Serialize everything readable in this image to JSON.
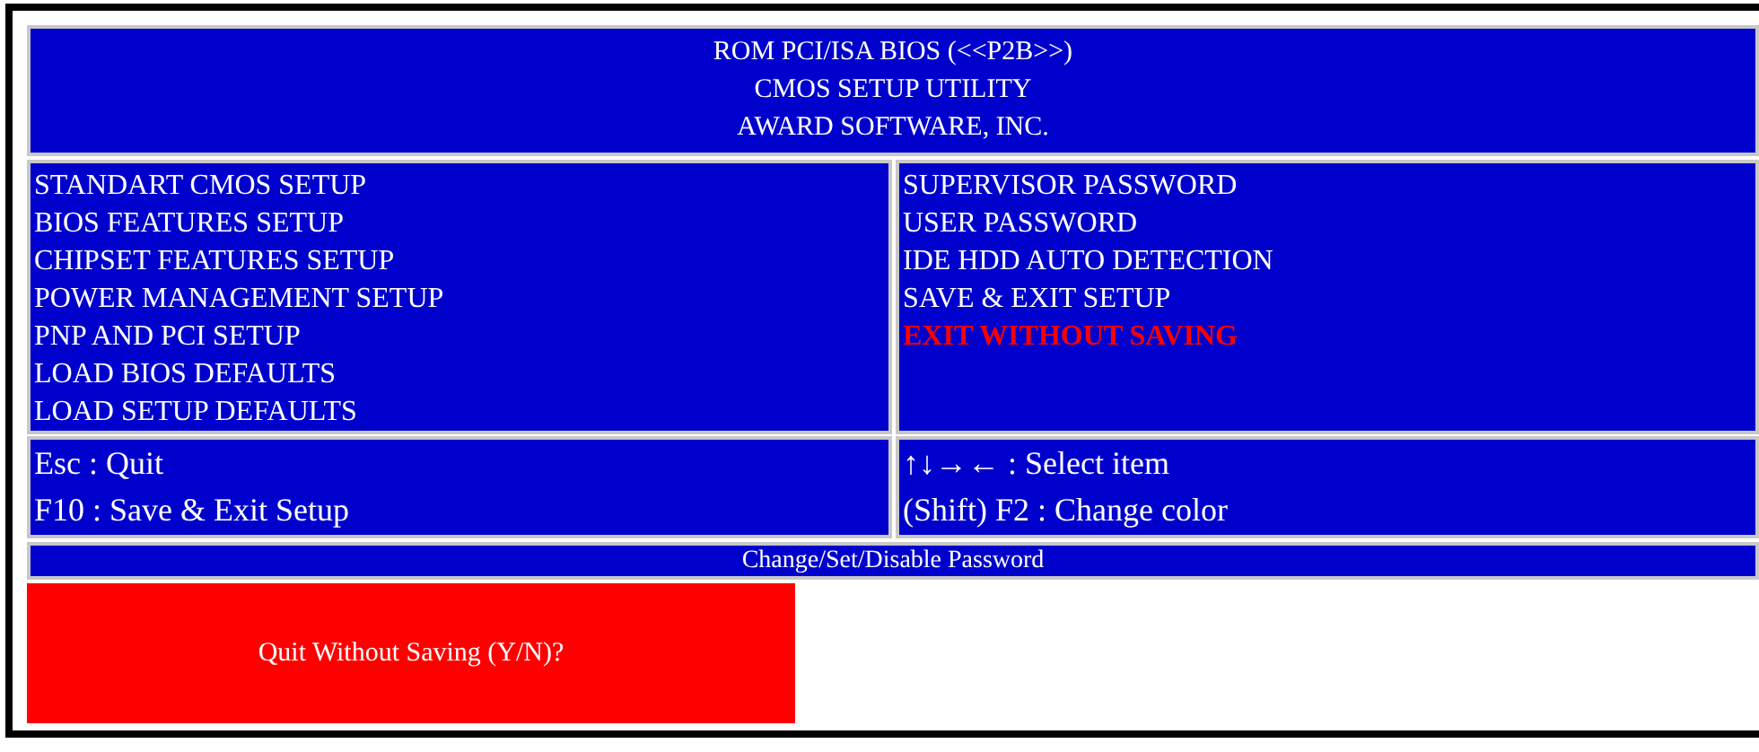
{
  "header": {
    "lines": [
      "ROM PCI/ISA BIOS (<<P2B>>)",
      "CMOS SETUP UTILITY",
      "AWARD SOFTWARE, INC."
    ]
  },
  "menu_columns": [
    {
      "items": [
        {
          "label": "STANDART CMOS SETUP",
          "selected": false
        },
        {
          "label": "BIOS FEATURES SETUP",
          "selected": false
        },
        {
          "label": "CHIPSET FEATURES SETUP",
          "selected": false
        },
        {
          "label": "POWER MANAGEMENT SETUP",
          "selected": false
        },
        {
          "label": "PNP AND PCI SETUP",
          "selected": false
        },
        {
          "label": "LOAD BIOS DEFAULTS",
          "selected": false
        },
        {
          "label": "LOAD SETUP DEFAULTS",
          "selected": false
        }
      ]
    },
    {
      "items": [
        {
          "label": "SUPERVISOR PASSWORD",
          "selected": false
        },
        {
          "label": "USER PASSWORD",
          "selected": false
        },
        {
          "label": "IDE HDD AUTO DETECTION",
          "selected": false
        },
        {
          "label": "SAVE & EXIT SETUP",
          "selected": false
        },
        {
          "label": "EXIT WITHOUT SAVING",
          "selected": true
        }
      ]
    }
  ],
  "key_help": [
    [
      "Esc : Quit",
      "F10 : Save & Exit Setup"
    ],
    [
      "↑↓→← : Select item",
      "(Shift) F2 : Change color"
    ]
  ],
  "status_bar": "Change/Set/Disable Password",
  "prompt": "Quit Without Saving (Y/N)?"
}
